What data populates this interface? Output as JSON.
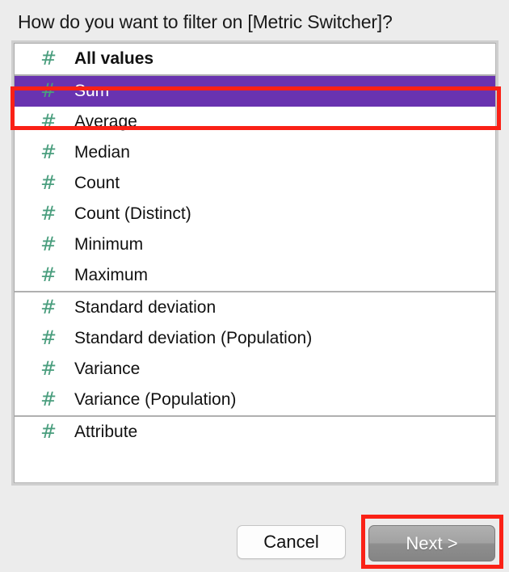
{
  "dialog": {
    "title": "How do you want to filter on [Metric Switcher]?"
  },
  "list": {
    "groups": [
      {
        "items": [
          {
            "label": "All values",
            "icon": "hash-icon",
            "bold": true,
            "selected": false
          }
        ]
      },
      {
        "items": [
          {
            "label": "Sum",
            "icon": "hash-icon",
            "bold": false,
            "selected": true
          },
          {
            "label": "Average",
            "icon": "hash-icon",
            "bold": false,
            "selected": false
          },
          {
            "label": "Median",
            "icon": "hash-icon",
            "bold": false,
            "selected": false
          },
          {
            "label": "Count",
            "icon": "hash-icon",
            "bold": false,
            "selected": false
          },
          {
            "label": "Count (Distinct)",
            "icon": "hash-icon",
            "bold": false,
            "selected": false
          },
          {
            "label": "Minimum",
            "icon": "hash-icon",
            "bold": false,
            "selected": false
          },
          {
            "label": "Maximum",
            "icon": "hash-icon",
            "bold": false,
            "selected": false
          }
        ]
      },
      {
        "items": [
          {
            "label": "Standard deviation",
            "icon": "hash-icon",
            "bold": false,
            "selected": false
          },
          {
            "label": "Standard deviation (Population)",
            "icon": "hash-icon",
            "bold": false,
            "selected": false
          },
          {
            "label": "Variance",
            "icon": "hash-icon",
            "bold": false,
            "selected": false
          },
          {
            "label": "Variance (Population)",
            "icon": "hash-icon",
            "bold": false,
            "selected": false
          }
        ]
      },
      {
        "items": [
          {
            "label": "Attribute",
            "icon": "hash-icon",
            "bold": false,
            "selected": false
          }
        ]
      }
    ],
    "icon_glyph": "#"
  },
  "footer": {
    "cancel_label": "Cancel",
    "next_label": "Next >"
  },
  "annotations": {
    "color": "#fa2116",
    "targets": [
      "Sum",
      "Next >"
    ]
  },
  "colors": {
    "selection": "#6933b0",
    "icon": "#4a9e7e",
    "background": "#ececec",
    "annotation": "#fa2116"
  }
}
